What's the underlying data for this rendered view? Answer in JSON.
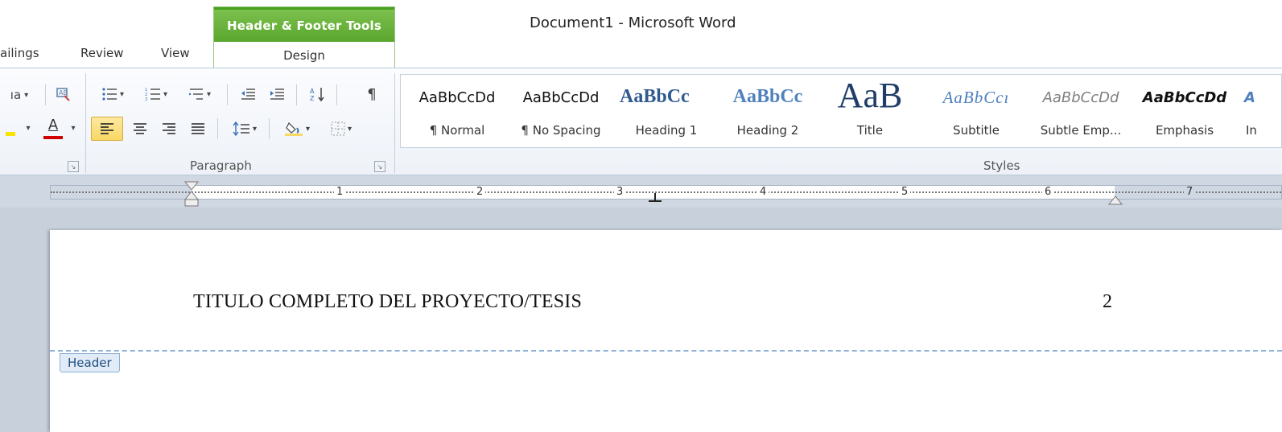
{
  "window": {
    "title": "Document1  -  Microsoft Word"
  },
  "contextual_tab": {
    "group": "Header & Footer Tools",
    "tab": "Design"
  },
  "tabs": [
    "ailings",
    "Review",
    "View"
  ],
  "ribbon": {
    "font_group": {
      "aa_label": "ıa",
      "font_color_letter": "A"
    },
    "paragraph_label": "Paragraph",
    "styles_label": "Styles",
    "styles": [
      {
        "sample": "AaBbCcDd",
        "name": "¶ Normal"
      },
      {
        "sample": "AaBbCcDd",
        "name": "¶ No Spacing"
      },
      {
        "sample": "AaBbCc",
        "name": "Heading 1"
      },
      {
        "sample": "AaBbCc",
        "name": "Heading 2"
      },
      {
        "sample": "AaB",
        "name": "Title"
      },
      {
        "sample": "AaBbCcı",
        "name": "Subtitle"
      },
      {
        "sample": "AaBbCcDd",
        "name": "Subtle Emp..."
      },
      {
        "sample": "AaBbCcDd",
        "name": "Emphasis"
      },
      {
        "sample": "A",
        "name": "In"
      }
    ],
    "accent_color": "#f8d865",
    "font_red": "#d00000"
  },
  "ruler": {
    "numbers": [
      "1",
      "2",
      "3",
      "4",
      "5",
      "6",
      "7"
    ]
  },
  "document": {
    "header_text": "TITULO COMPLETO DEL PROYECTO/TESIS",
    "page_number": "2",
    "header_tag": "Header"
  }
}
